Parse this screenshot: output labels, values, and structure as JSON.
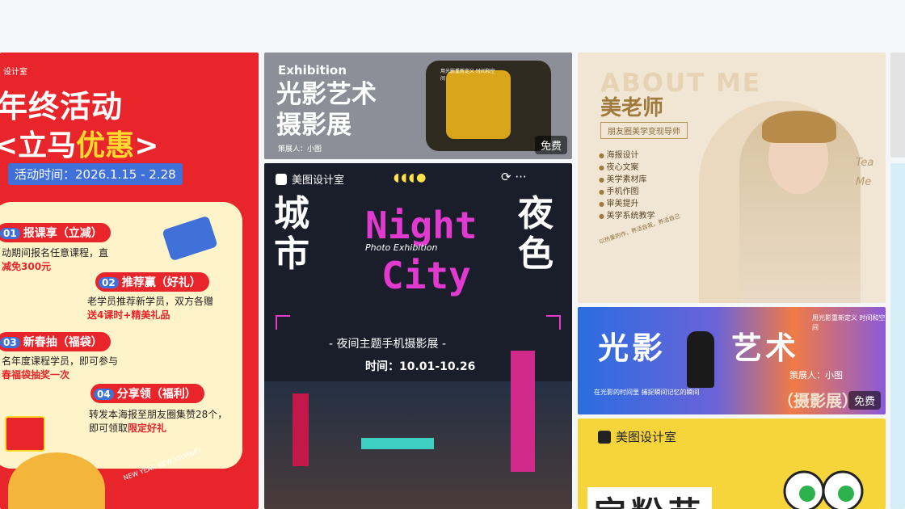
{
  "card1": {
    "brand": "设计室",
    "headline1": "年终活动",
    "headline2_pre": "<立马",
    "headline2_hl": "优惠",
    "headline2_post": ">",
    "date": "活动时间：2026.1.15 - 2.28",
    "items": [
      {
        "num": "01",
        "title": "报课享（立减）",
        "text1": "动期间报名任意课程，直",
        "text2": "减免300元"
      },
      {
        "num": "02",
        "title": "推荐赢（好礼）",
        "text1": "老学员推荐新学员，双方各赠",
        "text2": "送4课时+精美礼品"
      },
      {
        "num": "03",
        "title": "新春抽（福袋）",
        "text1": "名年度课程学员，即可参与",
        "text2": "春福袋抽奖一次"
      },
      {
        "num": "04",
        "title": "分享领（福利）",
        "text1": "转发本海报至朋友圈集赞28个，",
        "text2_pre": "即可领取",
        "text2_hl": "限定好礼"
      }
    ],
    "footer_script": "NEW YEAR NEW JOURNEY"
  },
  "card2": {
    "en": "Exhibition",
    "title1": "光影艺术",
    "title2": "摄影展",
    "curator": "策展人：小图",
    "small": "用光影重新定义 时间和空间",
    "badge": "免费"
  },
  "card3": {
    "brand": "美图设计室",
    "moons": "◖◖◖●",
    "icons": "⟳  ···",
    "left_v": "城市",
    "right_v": "夜色",
    "night": "Night",
    "photo": "Photo  Exhibition",
    "city": "City",
    "subtitle": "- 夜间主题手机摄影展 -",
    "time": "时间：10.01-10.26"
  },
  "card4": {
    "about": "ABOUT ME",
    "name": "美老师",
    "role": "朋友圈美学变现导师",
    "list": [
      "海报设计",
      "夜心文案",
      "美学素材库",
      "手机作图",
      "审美提升",
      "美学系统教学"
    ],
    "note": "以热爱的作，养活自我，养活自己",
    "script": "Tea Me"
  },
  "card5": {
    "t1": "光影",
    "t2": "艺术",
    "top": "用光影重新定义 时间和空间",
    "curator": "策展人：小图",
    "sub": "（摄影展）",
    "tl": "在光影的时间里 捕捉瞬间记忆的瞬间",
    "badge": "免费"
  },
  "card6": {
    "brand": "美图设计室",
    "big": "宝粉节"
  }
}
